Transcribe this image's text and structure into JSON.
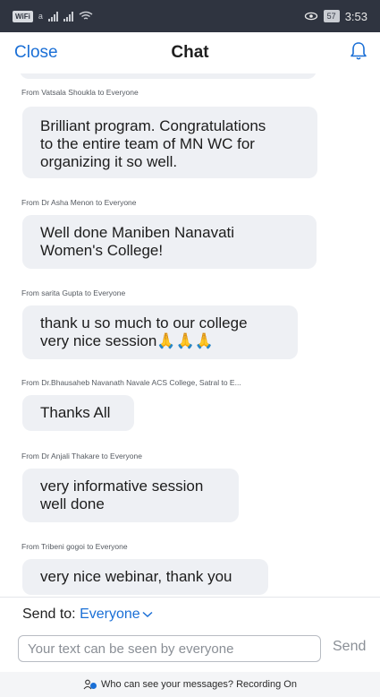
{
  "status_bar": {
    "wifi_label": "WiFi",
    "wifi_suffix": "a",
    "battery": "57",
    "time": "3:53"
  },
  "header": {
    "close_label": "Close",
    "title": "Chat"
  },
  "messages": [
    {
      "sender": "From Vatsala Shoukla to Everyone",
      "lines": [
        "Brilliant program. Congratulations",
        "to the entire team of MN WC for",
        "organizing it so well."
      ]
    },
    {
      "sender": "From Dr Asha Menon to Everyone",
      "lines": [
        "Well done Maniben  Nanavati",
        "Women's College!"
      ]
    },
    {
      "sender": "From sarita Gupta to Everyone",
      "lines": [
        "thank u so much to  our  college",
        "very nice session🙏🙏🙏"
      ]
    },
    {
      "sender": "From Dr.Bhausaheb Navanath Navale ACS College, Satral to E...",
      "lines": [
        "Thanks All"
      ]
    },
    {
      "sender": "From Dr Anjali Thakare to Everyone",
      "lines": [
        "very informative session",
        "well done"
      ]
    },
    {
      "sender": "From Tribeni gogoi to Everyone",
      "lines": [
        "very nice webinar,  thank you"
      ]
    }
  ],
  "composer": {
    "send_to_label": "Send to:",
    "recipient": "Everyone",
    "placeholder": "Your text can be seen by everyone",
    "send_label": "Send"
  },
  "footer": {
    "text": "Who can see your messages? Recording On"
  },
  "colors": {
    "accent": "#1a6fd6",
    "bubble": "#eef0f4",
    "status_bar": "#2f3440"
  }
}
